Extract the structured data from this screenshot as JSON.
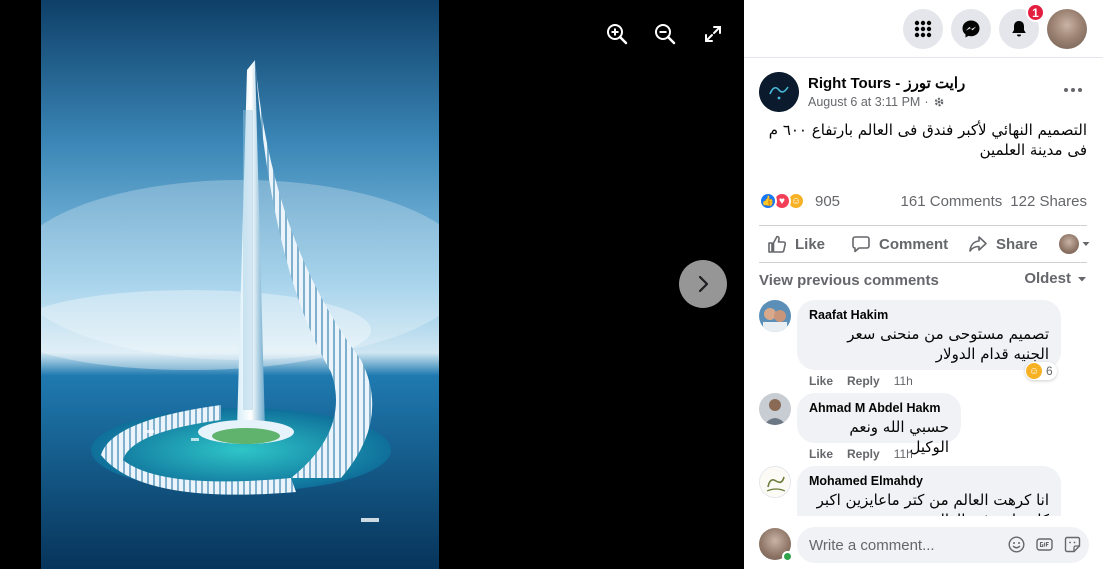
{
  "viewer": {
    "zoom_in_icon": "zoom-in-icon",
    "zoom_out_icon": "zoom-out-icon",
    "fullscreen_icon": "expand-icon",
    "next_icon": "chevron-right-icon"
  },
  "topbar": {
    "menu_icon": "grid-menu-icon",
    "messenger_icon": "messenger-icon",
    "notifications_icon": "bell-icon",
    "notifications_count": "1"
  },
  "post": {
    "page_name": "Right Tours - رايت تورز",
    "date": "August 6 at 3:11 PM",
    "privacy_icon": "gear-icon",
    "text": "التصميم النهائي لأكبر فندق فى العالم بارتفاع ٦٠٠ م فى مدينة العلمين",
    "reactions_count": "905",
    "comments_count": "161 Comments",
    "shares_count": "122 Shares",
    "like_label": "Like",
    "comment_label": "Comment",
    "share_label": "Share"
  },
  "comments_section": {
    "view_previous": "View previous comments",
    "sort": "Oldest",
    "items": [
      {
        "name": "Raafat Hakim",
        "text": "تصميم مستوحى من منحنى سعر الجنيه قدام الدولار",
        "like": "Like",
        "reply": "Reply",
        "time": "11h",
        "reaction_count": "6"
      },
      {
        "name": "Ahmad M Abdel Hakm",
        "text": "حسبي الله ونعم الوكيل",
        "like": "Like",
        "reply": "Reply",
        "time": "11h"
      },
      {
        "name": "Mohamed Elmahdy",
        "text": "انا كرهت العالم من كتر ماعايزين اكبر كل حاجة في العالم"
      }
    ]
  },
  "composer": {
    "placeholder": "Write a comment..."
  },
  "colors": {
    "accent": "#1877f2",
    "badge": "#e41e3f",
    "online": "#31a24c"
  }
}
